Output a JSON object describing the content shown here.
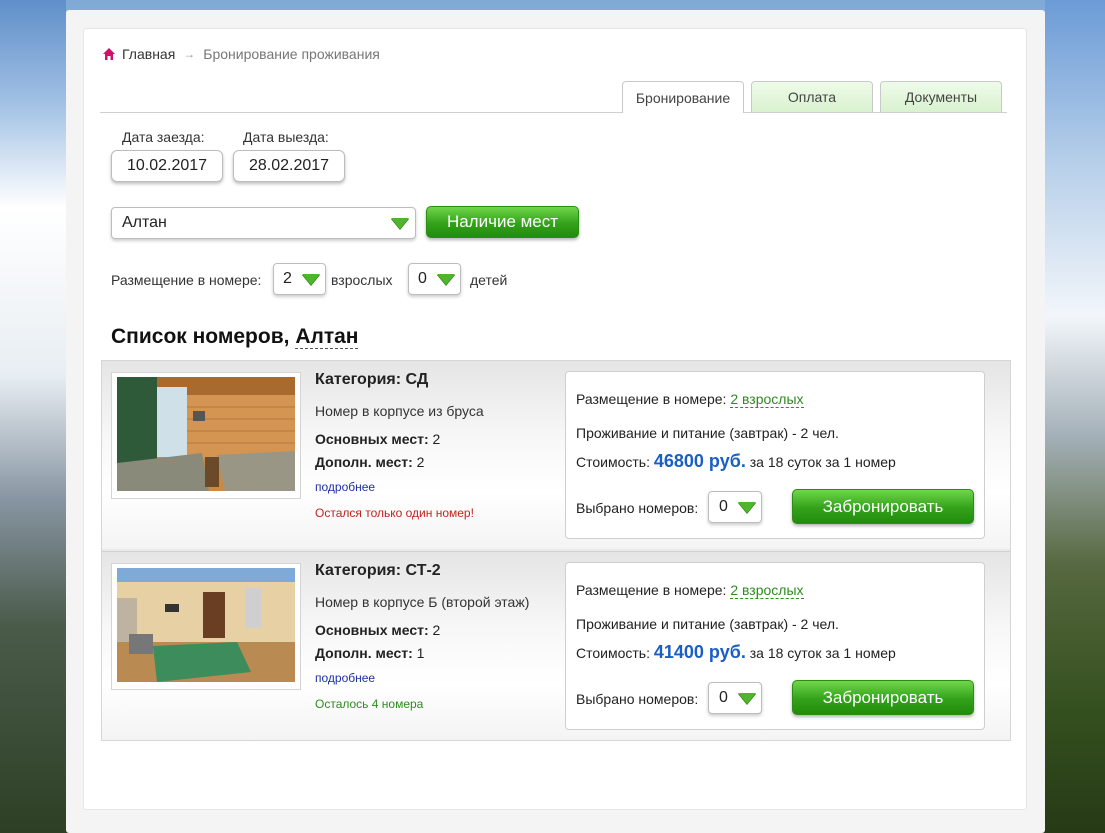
{
  "breadcrumb": {
    "home": "Главная",
    "separator": "→",
    "current": "Бронирование проживания"
  },
  "tabs": [
    {
      "label": "Бронирование",
      "active": true
    },
    {
      "label": "Оплата",
      "active": false
    },
    {
      "label": "Документы",
      "active": false
    }
  ],
  "dates": {
    "checkin_label": "Дата заезда:",
    "checkin_value": "10.02.2017",
    "checkout_label": "Дата выезда:",
    "checkout_value": "28.02.2017"
  },
  "hotel_select": {
    "value": "Алтан"
  },
  "availability_button": "Наличие мест",
  "guests": {
    "label": "Размещение в номере:",
    "adults_value": "2",
    "adults_label": "взрослых",
    "children_value": "0",
    "children_label": "детей"
  },
  "list": {
    "title_prefix": "Список номеров,",
    "hotel": "Алтан"
  },
  "rooms": [
    {
      "category_label": "Категория:",
      "category": "СД",
      "description": "Номер в корпусе из бруса",
      "main_label": "Основных мест:",
      "main": "2",
      "extra_label": "Дополн. мест:",
      "extra": "2",
      "more": "подробнее",
      "availability": "Остался только один номер!",
      "placement_label": "Размещение в номере:",
      "placement": "2 взрослых",
      "meals": "Проживание и питание (завтрак) - 2 чел.",
      "cost_label": "Стоимость:",
      "price": "46800 руб.",
      "price_note": "за 18 суток за 1 номер",
      "selected_label": "Выбрано номеров:",
      "selected": "0",
      "book_button": "Забронировать"
    },
    {
      "category_label": "Категория:",
      "category": "СТ-2",
      "description": "Номер в корпусе Б (второй этаж)",
      "main_label": "Основных мест:",
      "main": "2",
      "extra_label": "Дополн. мест:",
      "extra": "1",
      "more": "подробнее",
      "availability": "Осталось 4 номера",
      "placement_label": "Размещение в номере:",
      "placement": "2 взрослых",
      "meals": "Проживание и питание (завтрак) - 2 чел.",
      "cost_label": "Стоимость:",
      "price": "41400 руб.",
      "price_note": "за 18 суток за 1 номер",
      "selected_label": "Выбрано номеров:",
      "selected": "0",
      "book_button": "Забронировать"
    }
  ],
  "colors": {
    "accent_green": "#33a21a",
    "price_blue": "#1a5fc4",
    "warn_red": "#c0241e",
    "ok_green": "#2e8b1e"
  }
}
